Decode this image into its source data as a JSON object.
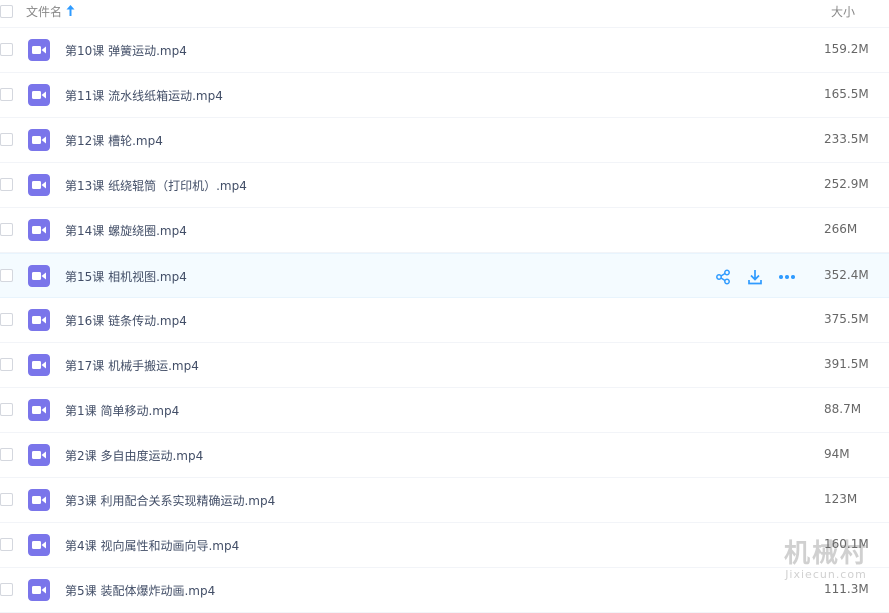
{
  "header": {
    "name_label": "文件名",
    "sort_icon": "arrow-up-icon",
    "size_label": "大小"
  },
  "files": [
    {
      "name": "第10课 弹簧运动.mp4",
      "size": "159.2M"
    },
    {
      "name": "第11课 流水线纸箱运动.mp4",
      "size": "165.5M"
    },
    {
      "name": "第12课 槽轮.mp4",
      "size": "233.5M"
    },
    {
      "name": "第13课 纸绕辊筒（打印机）.mp4",
      "size": "252.9M"
    },
    {
      "name": "第14课 螺旋绕圈.mp4",
      "size": "266M"
    },
    {
      "name": "第15课 相机视图.mp4",
      "size": "352.4M"
    },
    {
      "name": "第16课 链条传动.mp4",
      "size": "375.5M"
    },
    {
      "name": "第17课 机械手搬运.mp4",
      "size": "391.5M"
    },
    {
      "name": "第1课 简单移动.mp4",
      "size": "88.7M"
    },
    {
      "name": "第2课 多自由度运动.mp4",
      "size": "94M"
    },
    {
      "name": "第3课 利用配合关系实现精确运动.mp4",
      "size": "123M"
    },
    {
      "name": "第4课 视向属性和动画向导.mp4",
      "size": "160.1M"
    },
    {
      "name": "第5课 装配体爆炸动画.mp4",
      "size": "111.3M"
    }
  ],
  "hovered_row_actions": [
    "share-icon",
    "download-icon",
    "more-icon"
  ],
  "colors": {
    "file_icon": "#7a75ea",
    "accent": "#2f9bff",
    "hover_bg": "#f4fbff"
  },
  "watermark": {
    "main": "机械村",
    "sub": "Jixiecun.com"
  }
}
